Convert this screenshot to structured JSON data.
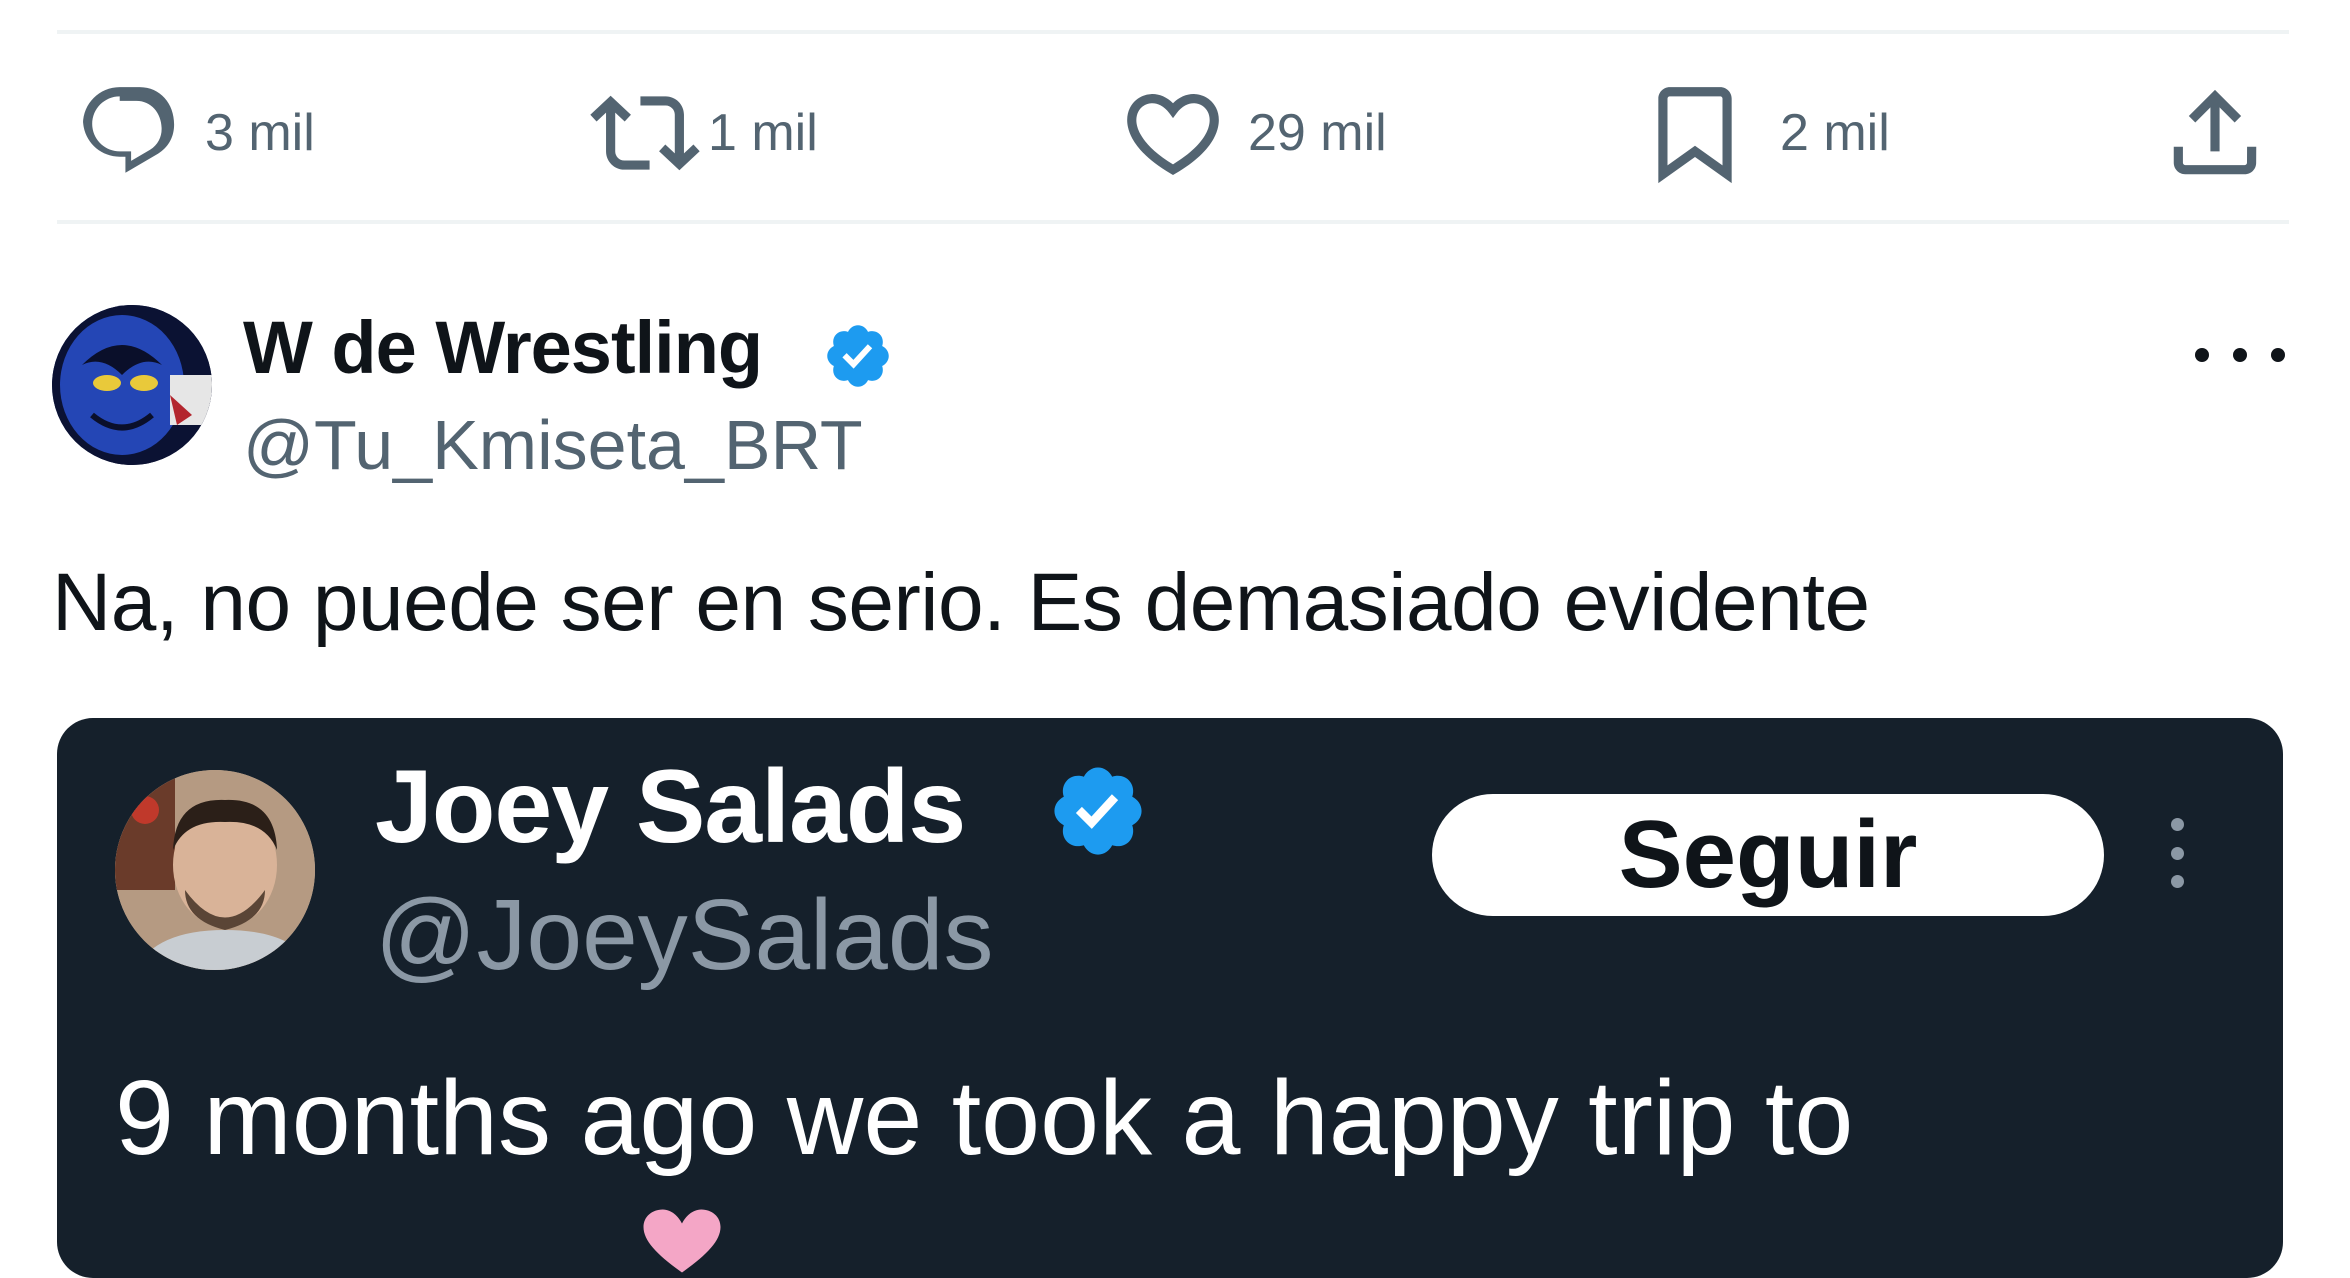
{
  "actions": {
    "reply_count": "3 mil",
    "retweet_count": "1 mil",
    "like_count": "29 mil",
    "bookmark_count": "2 mil"
  },
  "post": {
    "author_name": "W de Wrestling",
    "author_handle": "@Tu_Kmiseta_BRT",
    "text": "Na, no puede ser en serio. Es demasiado evidente"
  },
  "embedded": {
    "author_name": "Joey Salads",
    "author_handle": "@JoeySalads",
    "follow_label": "Seguir",
    "text": "9 months ago we took a happy trip to"
  },
  "icons": [
    "reply-icon",
    "retweet-icon",
    "like-icon",
    "bookmark-icon",
    "share-icon",
    "verified-badge-icon",
    "more-icon"
  ],
  "colors": {
    "verified": "#1d9bf0",
    "secondary_text": "#536471",
    "embed_background": "#15202b",
    "divider": "#eff3f4"
  }
}
